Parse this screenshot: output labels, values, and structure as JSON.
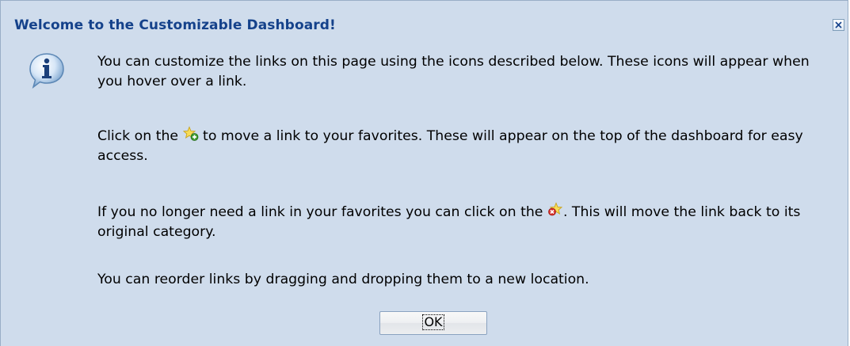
{
  "dialog": {
    "title": "Welcome to the Customizable Dashboard!",
    "close_icon": "close-icon",
    "info_icon": "info-icon",
    "paragraph1": "You can customize the links on this page using the icons described below. These icons will appear when you hover over a link.",
    "paragraph2_before": "Click on the ",
    "paragraph2_icon": "star-add-icon",
    "paragraph2_after": " to move a link to your favorites. These will appear on the top of the dashboard for easy access.",
    "paragraph3_before": "If you no longer need a link in your favorites you can click on the ",
    "paragraph3_icon": "star-remove-icon",
    "paragraph3_after": ". This will move the link back to its original category.",
    "paragraph4": "You can reorder links by dragging and dropping them to a new location.",
    "ok_label": "OK"
  },
  "colors": {
    "background": "#cfdcec",
    "title": "#15428b",
    "border": "#99aec7"
  }
}
